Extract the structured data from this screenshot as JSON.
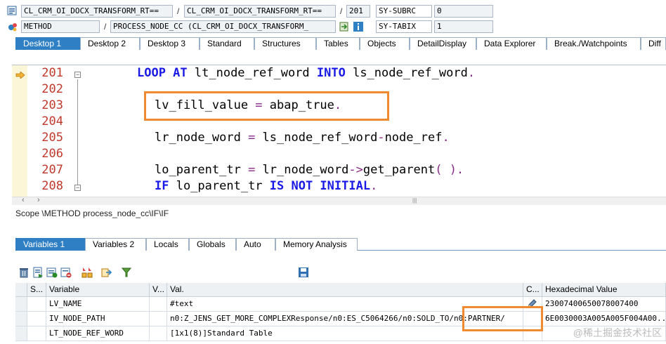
{
  "header": {
    "row1": {
      "program": "CL_CRM_OI_DOCX_TRANSFORM_RT==",
      "include": "CL_CRM_OI_DOCX_TRANSFORM_RT==",
      "line": "201",
      "var_name": "SY-SUBRC",
      "var_value": "0"
    },
    "row2": {
      "type": "METHOD",
      "event": "PROCESS_NODE_CC (CL_CRM_OI_DOCX_TRANSFORM_",
      "var_name": "SY-TABIX",
      "var_value": "1"
    },
    "separator": "/"
  },
  "desktop_tabs": [
    "Desktop 1",
    "Desktop 2",
    "Desktop 3",
    "Standard",
    "Structures",
    "Tables",
    "Objects",
    "DetailDisplay",
    "Data Explorer",
    "Break./Watchpoints",
    "Diff"
  ],
  "code": {
    "lines": [
      {
        "num": "201",
        "parts": [
          {
            "t": "LOOP AT",
            "c": "kw"
          },
          {
            "t": " lt_node_ref_word ",
            "c": ""
          },
          {
            "t": "INTO",
            "c": "kw"
          },
          {
            "t": " ls_node_ref_word",
            "c": ""
          },
          {
            "t": ".",
            "c": "op"
          }
        ]
      },
      {
        "num": "202",
        "parts": []
      },
      {
        "num": "203",
        "parts": [
          {
            "t": "lv_fill_value ",
            "c": ""
          },
          {
            "t": "=",
            "c": "op"
          },
          {
            "t": " abap_true",
            "c": ""
          },
          {
            "t": ".",
            "c": "op"
          }
        ]
      },
      {
        "num": "204",
        "parts": []
      },
      {
        "num": "205",
        "parts": [
          {
            "t": "lr_node_word ",
            "c": ""
          },
          {
            "t": "=",
            "c": "op"
          },
          {
            "t": " ls_node_ref_word",
            "c": ""
          },
          {
            "t": "-",
            "c": "op"
          },
          {
            "t": "node_ref",
            "c": ""
          },
          {
            "t": ".",
            "c": "op"
          }
        ]
      },
      {
        "num": "206",
        "parts": []
      },
      {
        "num": "207",
        "parts": [
          {
            "t": "lo_parent_tr ",
            "c": ""
          },
          {
            "t": "=",
            "c": "op"
          },
          {
            "t": " lr_node_word",
            "c": ""
          },
          {
            "t": "->",
            "c": "op"
          },
          {
            "t": "get_parent",
            "c": ""
          },
          {
            "t": "( ).",
            "c": "op"
          }
        ]
      },
      {
        "num": "208",
        "parts": [
          {
            "t": "IF",
            "c": "kw"
          },
          {
            "t": " lo_parent_tr ",
            "c": ""
          },
          {
            "t": "IS NOT INITIAL",
            "c": "kw"
          },
          {
            "t": ".",
            "c": "op"
          }
        ]
      }
    ]
  },
  "scope_text": "Scope \\METHOD process_node_cc\\IF\\IF",
  "variable_tabs": [
    "Variables 1",
    "Variables 2",
    "Locals",
    "Globals",
    "Auto",
    "Memory Analysis"
  ],
  "table": {
    "headers": [
      "S...",
      "Variable",
      "V...",
      "Val.",
      "C...",
      "Hexadecimal Value"
    ],
    "rows": [
      {
        "variable": "LV_NAME",
        "value": "#text",
        "hex": "23007400650078007400"
      },
      {
        "variable": "IV_NODE_PATH",
        "value": "n0:Z_JENS_GET_MORE_COMPLEXResponse/n0:ES_C5064266/n0:SOLD_TO/n0:PARTNER/",
        "hex": "6E0030003A005A005F004A00..."
      },
      {
        "variable": "LT_NODE_REF_WORD",
        "value": "[1x1(8)]Standard Table",
        "hex": ""
      }
    ]
  },
  "watermark": "@稀土掘金技术社区",
  "colors": {
    "accent": "#2f7fc4",
    "highlight": "#f08a30",
    "keyword": "#1a1ae6",
    "line_number": "#c0392b"
  }
}
